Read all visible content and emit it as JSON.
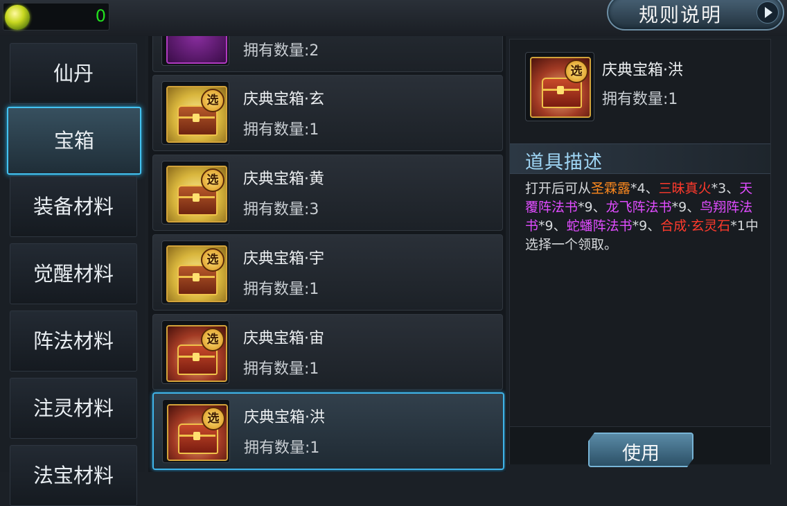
{
  "currency": {
    "value": "0"
  },
  "header": {
    "rules_label": "规则说明"
  },
  "categories": [
    {
      "label": "仙丹"
    },
    {
      "label": "宝箱",
      "active": true
    },
    {
      "label": "装备材料"
    },
    {
      "label": "觉醒材料"
    },
    {
      "label": "阵法材料"
    },
    {
      "label": "注灵材料"
    },
    {
      "label": "法宝材料"
    }
  ],
  "items": [
    {
      "name": "",
      "count": "拥有数量:2"
    },
    {
      "name": "庆典宝箱·玄",
      "count": "拥有数量:1"
    },
    {
      "name": "庆典宝箱·黄",
      "count": "拥有数量:3"
    },
    {
      "name": "庆典宝箱·宇",
      "count": "拥有数量:1"
    },
    {
      "name": "庆典宝箱·宙",
      "count": "拥有数量:1"
    },
    {
      "name": "庆典宝箱·洪",
      "count": "拥有数量:1"
    }
  ],
  "icon_badge": "选",
  "detail": {
    "name": "庆典宝箱·洪",
    "count": "拥有数量:1",
    "desc_title": "道具描述",
    "desc": {
      "t1": "打开后可从",
      "r1": "圣霖露",
      "t2": "*4、",
      "r2": "三昧真火",
      "t3": "*3、",
      "r3": "天覆阵法书",
      "t4": "*9、",
      "r4": "龙飞阵法书",
      "t5": "*9、",
      "r5": "鸟翔阵法书",
      "t6": "*9、",
      "r6": "蛇蟠阵法书",
      "t7": "*9、",
      "r7": "合成·玄灵石",
      "t8": "*1中选择一个领取。"
    }
  },
  "use_label": "使用"
}
